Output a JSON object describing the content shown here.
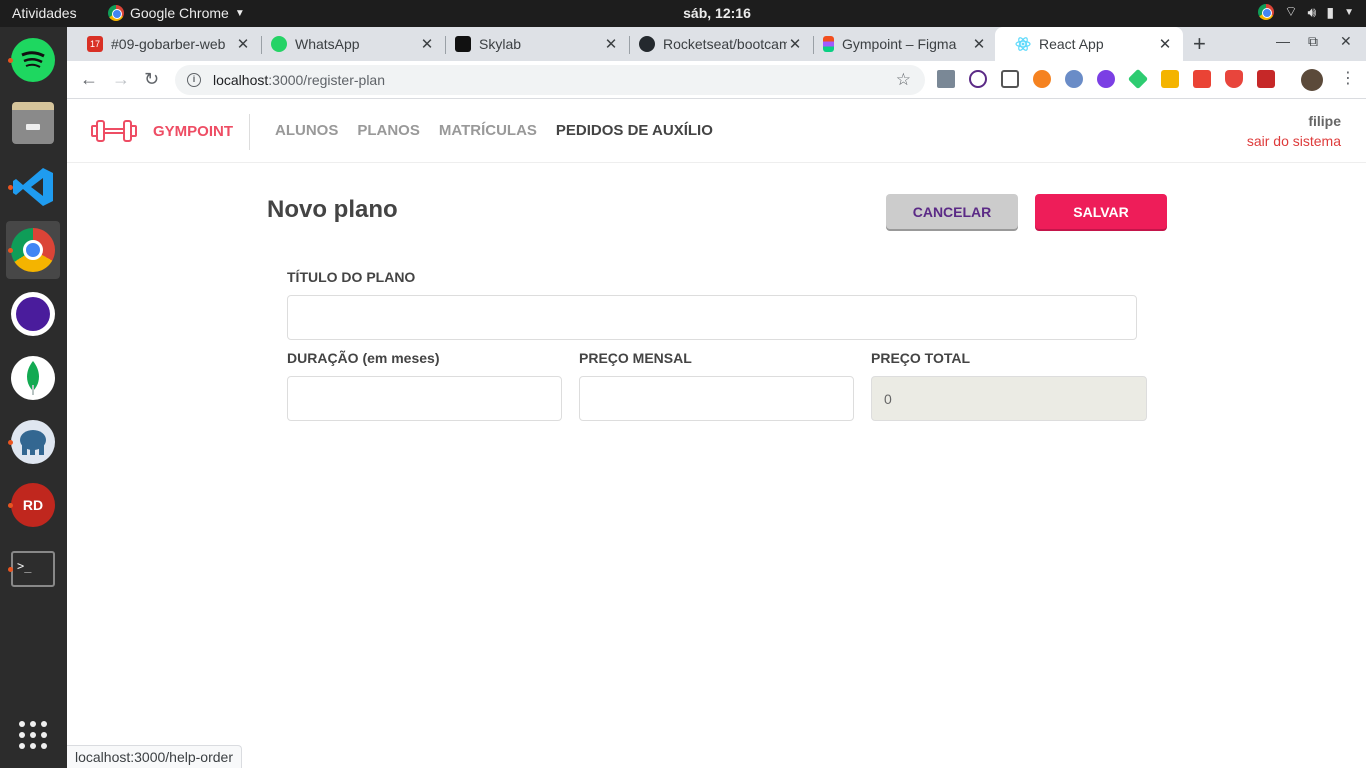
{
  "system": {
    "activities": "Atividades",
    "app_menu": "Google Chrome",
    "clock": "sáb, 12:16"
  },
  "dock": {
    "apps": [
      "spotify",
      "files",
      "vscode",
      "chrome",
      "tor-browser",
      "mongodb-compass",
      "postgres",
      "redis-manager",
      "terminal"
    ],
    "show_apps": "show-applications"
  },
  "tabs": [
    {
      "title": "#09-gobarber-web",
      "icon": "calendar-icon"
    },
    {
      "title": "WhatsApp",
      "icon": "whatsapp-icon"
    },
    {
      "title": "Skylab",
      "icon": "skylab-icon"
    },
    {
      "title": "Rocketseat/bootcamp",
      "icon": "github-icon"
    },
    {
      "title": "Gympoint – Figma",
      "icon": "figma-icon"
    },
    {
      "title": "React App",
      "icon": "react-icon",
      "active": true
    }
  ],
  "address": {
    "host": "localhost",
    "path": ":3000/register-plan"
  },
  "app": {
    "brand": "GYMPOINT",
    "nav": [
      {
        "label": "ALUNOS"
      },
      {
        "label": "PLANOS"
      },
      {
        "label": "MATRÍCULAS"
      },
      {
        "label": "PEDIDOS DE AUXÍLIO",
        "current": true
      }
    ],
    "user": {
      "name": "filipe",
      "logout": "sair do sistema"
    },
    "page_title": "Novo plano",
    "cancel_label": "CANCELAR",
    "save_label": "SALVAR",
    "form": {
      "title_label": "TÍTULO DO PLANO",
      "title_value": "",
      "duration_label": "DURAÇÃO (em meses)",
      "duration_value": "",
      "monthly_label": "PREÇO MENSAL",
      "monthly_value": "",
      "total_label": "PREÇO TOTAL",
      "total_value": "0"
    }
  },
  "status_url": "localhost:3000/help-order",
  "colors": {
    "brand": "#ee4d64",
    "save_button": "#ee1d59",
    "cancel_text": "#5b2a86",
    "logout": "#de3b3b"
  }
}
